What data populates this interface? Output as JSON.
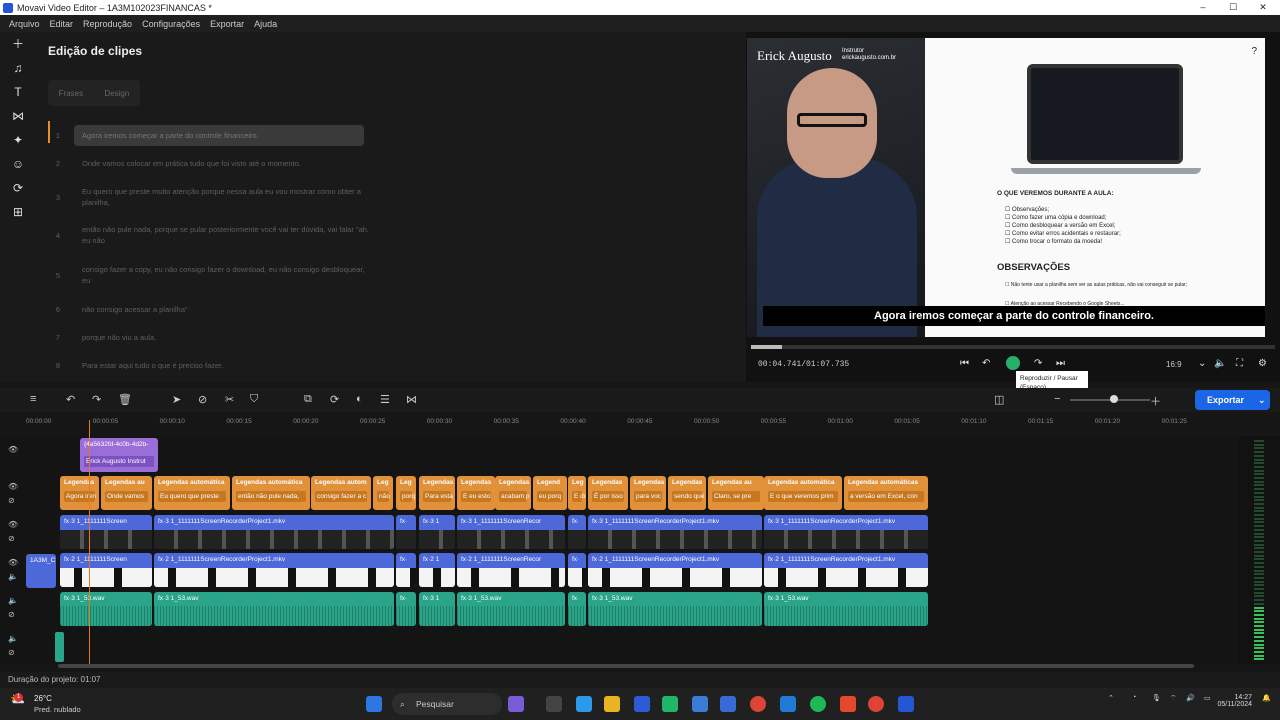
{
  "window": {
    "title": "Movavi Video Editor – 1A3M102023FINANCAS *",
    "min": "–",
    "max": "☐",
    "close": "✕"
  },
  "menu": [
    "Arquivo",
    "Editar",
    "Reprodução",
    "Configurações",
    "Exportar",
    "Ajuda"
  ],
  "left_tools": [
    "plus-icon",
    "music-icon",
    "text-icon",
    "transition-icon",
    "magic-icon",
    "sticker-icon",
    "filter-icon",
    "more-icon"
  ],
  "editor": {
    "title": "Edição de clipes",
    "tabs": [
      "Frases",
      "Design"
    ],
    "phrases": [
      {
        "n": "1",
        "t": "Agora iremos começar a parte do controle financeiro."
      },
      {
        "n": "2",
        "t": "Onde vamos colocar em prática tudo que foi visto até o momento."
      },
      {
        "n": "3",
        "t": "Eu quero que preste muito atenção porque nessa aula eu vou mostrar como obter a planilha,"
      },
      {
        "n": "4",
        "t": "então não pule nada, porque se pular posteriormente você vai ter dúvida, vai falar \"ah, eu não"
      },
      {
        "n": "5",
        "t": "consigo fazer a copy, eu não consigo fazer o download, eu não consigo desbloquear, eu"
      },
      {
        "n": "6",
        "t": "não consigo acessar a planilha\""
      },
      {
        "n": "7",
        "t": "porque não viu a aula."
      },
      {
        "n": "8",
        "t": "Para estar aqui tudo o que é preciso fazer."
      }
    ]
  },
  "preview": {
    "name": "Erick Augusto",
    "role": "Instrutor",
    "site": "erickaugusto.com.br",
    "h1": "O QUE VEREMOS DURANTE A AULA:",
    "list": [
      "☐ Observações;",
      "☐ Como fazer uma cópia e download;",
      "☐ Como desbloquear a versão em Excel;",
      "☐ Como evitar erros acidentais e restaurar;",
      "☐ Como trocar o formato da moeda!"
    ],
    "h2": "OBSERVAÇÕES",
    "list2": [
      "☐ Não tente usar a planilha sem ver as aulas práticas, não vai conseguir se pular;",
      "☐ Atenção ao acessar Recebendo o Google Sheets..."
    ],
    "caption": "Agora iremos começar a parte do controle financeiro.",
    "progress": 0.06,
    "timecode": "00:04.741/01:07.735",
    "ratio": "16:9",
    "tooltip_title": "Reproduzir / Pausar",
    "tooltip_key": "(Espaço)"
  },
  "toolbar": {
    "export": "Exportar"
  },
  "ruler": [
    "00:00:00",
    "00:00:05",
    "00:00:10",
    "00:00:15",
    "00:00:20",
    "00:00:25",
    "00:00:30",
    "00:00:35",
    "00:00:40",
    "00:00:45",
    "00:00:50",
    "00:00:55",
    "00:01:00",
    "00:01:05",
    "00:01:10",
    "00:01:15",
    "00:01:20",
    "00:01:25"
  ],
  "title_clip": {
    "l1": "{4a5632fd-4c0b-4d2b-",
    "l2": "Erick Augusto Instrut"
  },
  "captions": [
    {
      "l1": "Legendas",
      "l2": "Agora iren"
    },
    {
      "l1": "Legendas au",
      "l2": "Onde vamos"
    },
    {
      "l1": "Legendas automática",
      "l2": "Eu quero que preste"
    },
    {
      "l1": "Legendas automática",
      "l2": "então não pule nada,"
    },
    {
      "l1": "Legendas autom",
      "l2": "consigo fazer a c"
    },
    {
      "l1": "Leg",
      "l2": "não"
    },
    {
      "l1": "Leg",
      "l2": "porq"
    },
    {
      "l1": "Legendas",
      "l2": "Para esta"
    },
    {
      "l1": "Legendas",
      "l2": "E eu esto"
    },
    {
      "l1": "Legendas",
      "l2": "acabam p"
    },
    {
      "l1": "Legend",
      "l2": "eu porq"
    },
    {
      "l1": "Leg",
      "l2": "E do"
    },
    {
      "l1": "Legendas",
      "l2": "É por isso"
    },
    {
      "l1": "Legendas",
      "l2": "para voc"
    },
    {
      "l1": "Legendas",
      "l2": "sendo que"
    },
    {
      "l1": "Legendas au",
      "l2": "Claro, se pre"
    },
    {
      "l1": "Legendas automática",
      "l2": "E o que veremos prim"
    },
    {
      "l1": "Legendas automáticas",
      "l2": "a versão em Excel, con"
    }
  ],
  "video_labels": [
    "fx·3  1_1111111Screen",
    "fx·3  1_1111111ScreenRecorderProject1.mkv",
    "fx·",
    "fx·3  1",
    "fx·3  1_1111111ScreenRecor",
    "fx·",
    "fx·3  1_1111111ScreenRecorderProject1.mkv",
    "fx·3  1_1111111ScreenRecorderProject1.mkv"
  ],
  "screen_labels": [
    "fx·2  1_1111111Screen",
    "fx·2  1_1111111ScreenRecorderProject1.mkv",
    "fx·",
    "fx·2  1",
    "fx·2  1_1111111ScreenRecor",
    "fx·",
    "fx·2  1_1111111ScreenRecorderProject1.mkv",
    "fx·2  1_1111111ScreenRecorderProject1.mkv"
  ],
  "audio_labels": [
    "fx·3  1_53.wav",
    "fx·3  1_53.wav",
    "fx·",
    "fx·3  1",
    "fx·3  1_53.wav",
    "fx·",
    "fx·3  1_53.wav",
    "fx·3  1_53.wav"
  ],
  "small_clip": "1A3M_C",
  "status": "Duração do projeto: 01:07",
  "taskbar": {
    "temp": "26°C",
    "weather": "Pred. nublado",
    "search": "Pesquisar",
    "time": "14:27",
    "date": "05/11/2024",
    "badge": "1"
  }
}
